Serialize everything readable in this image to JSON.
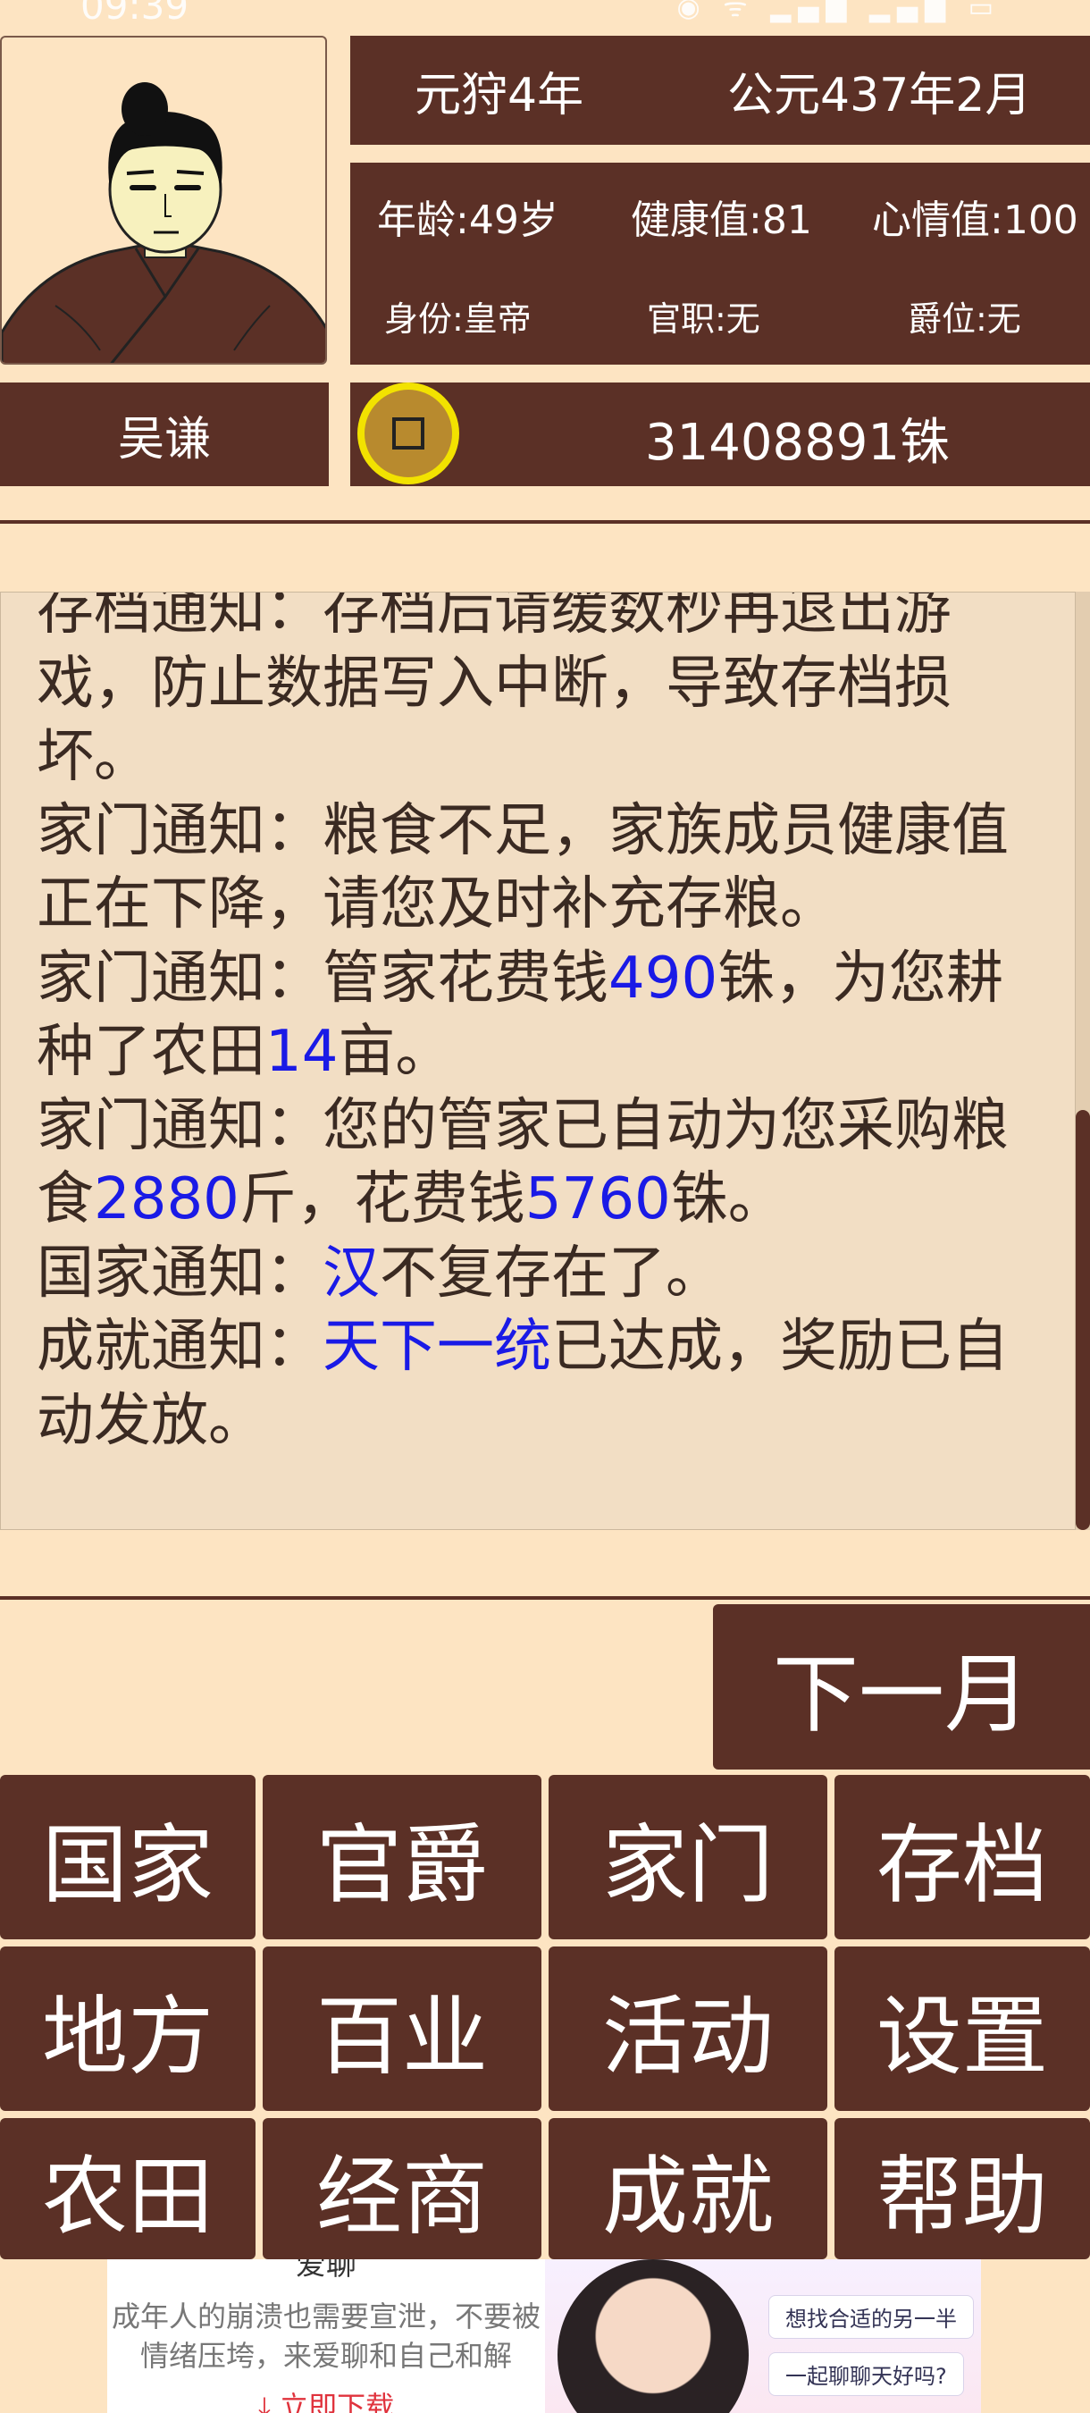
{
  "status_bar": {
    "time": "09:39",
    "icons": "◉ ᯤ ▂▄▆ ▂▄▆ ▭"
  },
  "header": {
    "reign_title": "元狩4年",
    "date": "公元437年2月",
    "age": "年龄:49岁",
    "health": "健康值:81",
    "mood": "心情值:100",
    "identity": "身份:皇帝",
    "office": "官职:无",
    "rank": "爵位:无",
    "name": "吴谦",
    "money": "31408891铢",
    "avatar_icon": "emperor-portrait-icon",
    "coin_icon": "copper-coin-icon"
  },
  "log": [
    {
      "parts": [
        {
          "text": "存档通知：存档后请缓数秒再退出游戏，防止数据写入中断，导致存档损坏。",
          "hl": false
        }
      ]
    },
    {
      "parts": [
        {
          "text": "家门通知：粮食不足，家族成员健康值正在下降，请您及时补充存粮。",
          "hl": false
        }
      ]
    },
    {
      "parts": [
        {
          "text": "家门通知：管家花费钱",
          "hl": false
        },
        {
          "text": "490",
          "hl": true
        },
        {
          "text": "铢，为您耕种了农田",
          "hl": false
        },
        {
          "text": "14",
          "hl": true
        },
        {
          "text": "亩。",
          "hl": false
        }
      ]
    },
    {
      "parts": [
        {
          "text": "家门通知：您的管家已自动为您采购粮食",
          "hl": false
        },
        {
          "text": "2880",
          "hl": true
        },
        {
          "text": "斤，花费钱",
          "hl": false
        },
        {
          "text": "5760",
          "hl": true
        },
        {
          "text": "铢。",
          "hl": false
        }
      ]
    },
    {
      "parts": [
        {
          "text": "国家通知：",
          "hl": false
        },
        {
          "text": "汉",
          "hl": true
        },
        {
          "text": "不复存在了。",
          "hl": false
        }
      ]
    },
    {
      "parts": [
        {
          "text": "成就通知：",
          "hl": false
        },
        {
          "text": "天下一统",
          "hl": true
        },
        {
          "text": "已达成，奖励已自动发放。",
          "hl": false
        }
      ]
    }
  ],
  "next_month_label": "下一月",
  "menu": [
    {
      "key": "state",
      "label": "国家"
    },
    {
      "key": "office",
      "label": "官爵"
    },
    {
      "key": "family",
      "label": "家门"
    },
    {
      "key": "save",
      "label": "存档"
    },
    {
      "key": "local",
      "label": "地方"
    },
    {
      "key": "trades",
      "label": "百业"
    },
    {
      "key": "activity",
      "label": "活动"
    },
    {
      "key": "settings",
      "label": "设置"
    },
    {
      "key": "farmland",
      "label": "农田"
    },
    {
      "key": "commerce",
      "label": "经商"
    },
    {
      "key": "achievement",
      "label": "成就"
    },
    {
      "key": "help",
      "label": "帮助"
    }
  ],
  "ad": {
    "title": "爱聊",
    "text": "成年人的崩溃也需要宣泄，不要被情绪压垮，来爱聊和自己和解",
    "download": "⤓ 立即下载",
    "bubble1": "想找合适的另一半",
    "bubble2": "一起聊聊天好吗?"
  },
  "colors": {
    "primary": "#5B3026",
    "background": "#FDE4C2",
    "log_bg": "#F2DEC4",
    "highlight": "#1A1AE6",
    "coin": "#F2E200"
  }
}
